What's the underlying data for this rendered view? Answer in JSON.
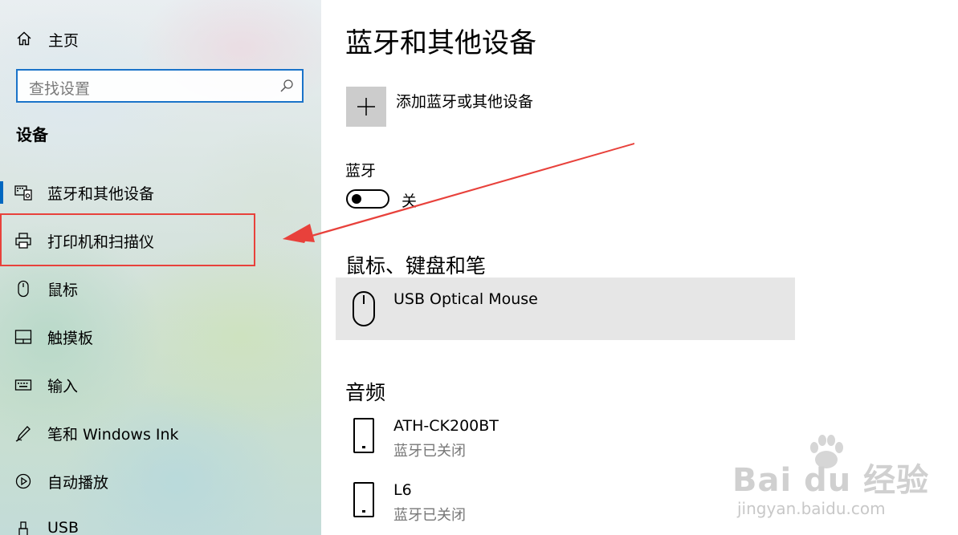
{
  "sidebar": {
    "home_label": "主页",
    "search_placeholder": "查找设置",
    "section_title": "设备",
    "items": [
      {
        "label": "蓝牙和其他设备",
        "icon": "bluetooth-devices-icon"
      },
      {
        "label": "打印机和扫描仪",
        "icon": "printer-icon"
      },
      {
        "label": "鼠标",
        "icon": "mouse-icon"
      },
      {
        "label": "触摸板",
        "icon": "touchpad-icon"
      },
      {
        "label": "输入",
        "icon": "keyboard-icon"
      },
      {
        "label": "笔和 Windows Ink",
        "icon": "pen-icon"
      },
      {
        "label": "自动播放",
        "icon": "autoplay-icon"
      },
      {
        "label": "USB",
        "icon": "usb-icon"
      }
    ],
    "active_index": 0
  },
  "main": {
    "title": "蓝牙和其他设备",
    "add_device_label": "添加蓝牙或其他设备",
    "bluetooth": {
      "title": "蓝牙",
      "state_label": "关"
    },
    "mouse_section": {
      "title": "鼠标、键盘和笔",
      "devices": [
        {
          "name": "USB Optical Mouse",
          "icon": "mouse-icon"
        }
      ]
    },
    "audio_section": {
      "title": "音频",
      "devices": [
        {
          "name": "ATH-CK200BT",
          "status": "蓝牙已关闭",
          "icon": "phone-device-icon"
        },
        {
          "name": "L6",
          "status": "蓝牙已关闭",
          "icon": "phone-device-icon"
        }
      ]
    }
  },
  "watermark": {
    "brand": "Bai du 经验",
    "url": "jingyan.baidu.com"
  },
  "colors": {
    "accent": "#0067c0",
    "search_border": "#1a73c9",
    "annotation_red": "#e8413b",
    "selected_row": "#e6e6e6",
    "add_button_bg": "#cccccc"
  }
}
